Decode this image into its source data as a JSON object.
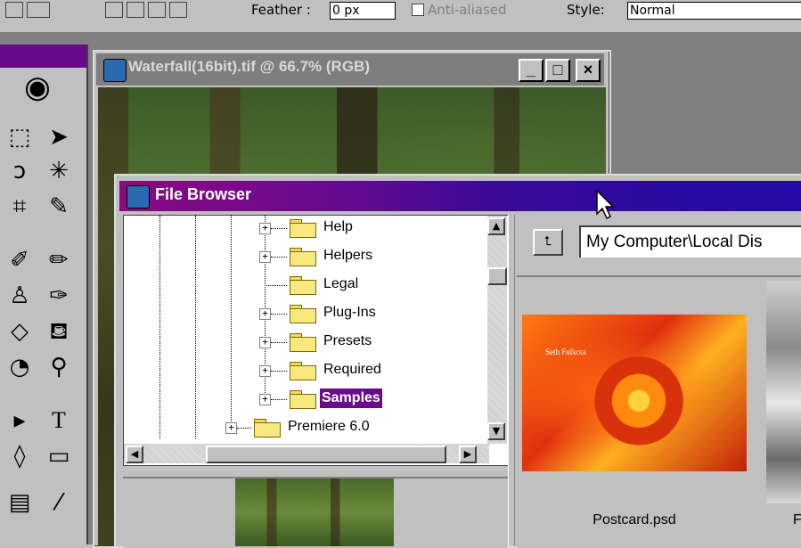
{
  "options_bar": {
    "feather_label": "Feather :",
    "feather_value": "0 px",
    "anti_aliased_label": "Anti-aliased",
    "style_label": "Style:",
    "style_value": "Normal"
  },
  "image_window": {
    "title": "Waterfall(16bit).tif @ 66.7% (RGB)",
    "minimize": "_",
    "maximize": "□",
    "close": "×"
  },
  "file_browser": {
    "title": "File Browser",
    "tree_items": [
      {
        "label": "Help",
        "expandable": true
      },
      {
        "label": "Helpers",
        "expandable": true
      },
      {
        "label": "Legal",
        "expandable": false
      },
      {
        "label": "Plug-Ins",
        "expandable": true
      },
      {
        "label": "Presets",
        "expandable": true
      },
      {
        "label": "Required",
        "expandable": true
      },
      {
        "label": "Samples",
        "expandable": true,
        "selected": true
      },
      {
        "label": "Premiere 6.0",
        "expandable": true
      }
    ],
    "path": "My Computer\\Local Dis",
    "thumbnails": [
      {
        "label": "Postcard.psd",
        "overlay_text": "Seth Fulkota"
      },
      {
        "label": "F"
      }
    ]
  },
  "colors": {
    "selection": "#6a0a8a",
    "title_gradient_start": "#8a0a80",
    "title_gradient_end": "#250aa8"
  }
}
